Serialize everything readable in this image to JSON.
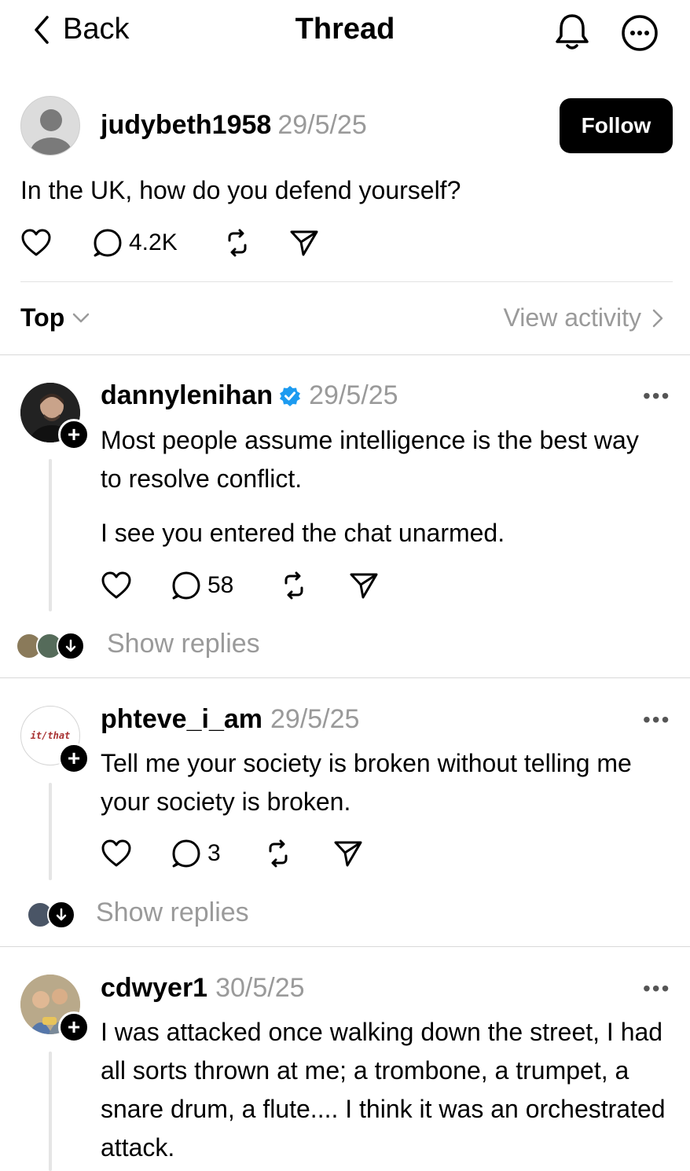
{
  "header": {
    "back_label": "Back",
    "title": "Thread",
    "bell_icon": "bell-icon",
    "more_icon": "more-circle-icon"
  },
  "post": {
    "username": "judybeth1958",
    "date": "29/5/25",
    "follow_label": "Follow",
    "text": "In the UK, how do you defend yourself?",
    "reply_count": "4.2K"
  },
  "sort": {
    "label": "Top",
    "view_activity": "View activity"
  },
  "replies": [
    {
      "username": "dannylenihan",
      "verified": true,
      "date": "29/5/25",
      "text_1": "Most people assume intelligence is the best way to resolve conflict.",
      "text_2": "I see you entered the chat unarmed.",
      "reply_count": "58",
      "show_replies": "Show replies"
    },
    {
      "username": "phteve_i_am",
      "date": "29/5/25",
      "avatar_text": "it/that",
      "text_1": "Tell me your society is broken without telling me your society is broken.",
      "reply_count": "3",
      "show_replies": "Show replies"
    },
    {
      "username": "cdwyer1",
      "date": "30/5/25",
      "text_1": "I was attacked once walking down the street, I had all sorts thrown at me; a trombone, a trumpet, a snare drum, a flute.... I think it was an orchestrated attack."
    }
  ],
  "colors": {
    "muted": "#9a9a9a",
    "verified": "#1d9bf0",
    "accent": "#000000"
  }
}
